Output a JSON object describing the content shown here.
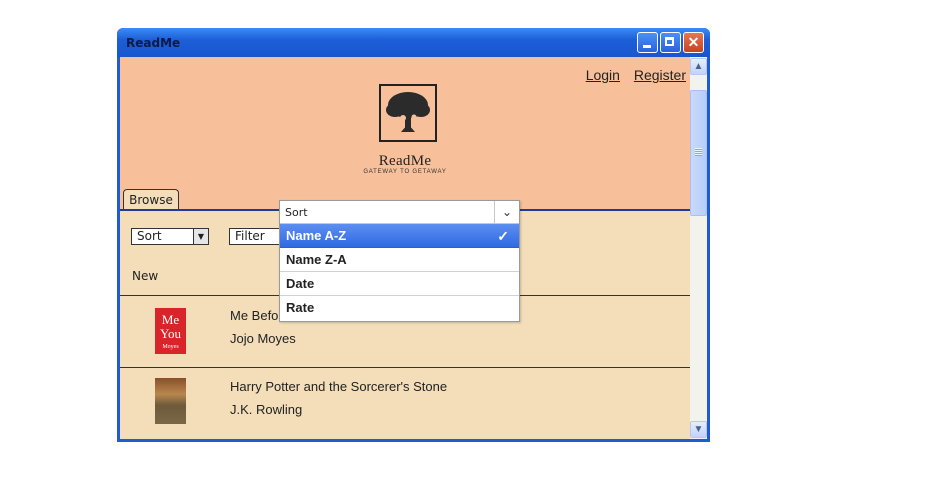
{
  "window": {
    "title": "ReadMe"
  },
  "header": {
    "login": "Login",
    "register": "Register",
    "brand": "ReadMe",
    "tagline": "GATEWAY TO GETAWAY",
    "tab": "Browse"
  },
  "toolbar": {
    "sort": "Sort",
    "filter": "Filter"
  },
  "section": {
    "label": "New"
  },
  "books": [
    {
      "cover_text": "Me Before You",
      "title": "Me Before You",
      "author": "Jojo Moyes"
    },
    {
      "title": "Harry Potter and the Sorcerer's Stone",
      "author": "J.K. Rowling"
    }
  ],
  "dropdown": {
    "header": "Sort",
    "options": [
      "Name A-Z",
      "Name Z-A",
      "Date",
      "Rate"
    ],
    "selected": "Name A-Z",
    "check": "✓"
  },
  "colors": {
    "header_bg": "#f7c09b",
    "body_bg": "#f3deb9",
    "selection": "#2f6ae3",
    "titlebar": "#1f5bd1"
  }
}
